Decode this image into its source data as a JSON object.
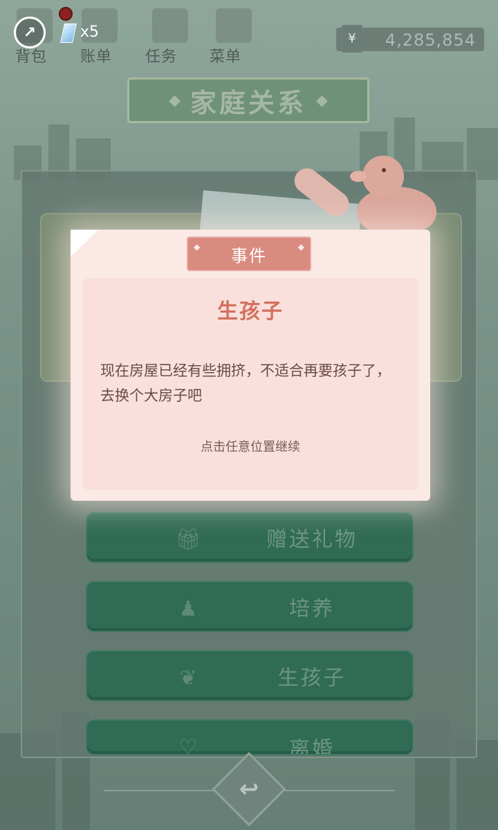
{
  "top_bar": {
    "ticket_count": "x5",
    "nav": [
      "背包",
      "账单",
      "任务",
      "菜单"
    ],
    "currency_symbol": "¥",
    "money": "4,285,854"
  },
  "banner": {
    "title": "家庭关系"
  },
  "actions": [
    {
      "label": "赠送礼物",
      "icon": "gift-icon"
    },
    {
      "label": "培养",
      "icon": "reading-child-icon"
    },
    {
      "label": "生孩子",
      "icon": "angel-icon"
    },
    {
      "label": "离婚",
      "icon": "broken-heart-icon"
    }
  ],
  "event_modal": {
    "tab_label": "事件",
    "title": "生孩子",
    "message": "现在房屋已经有些拥挤，不适合再要孩子了，去换个大房子吧",
    "hint": "点击任意位置继续"
  },
  "colors": {
    "action_button": "#2f6b55",
    "modal_background": "#fbe9e5",
    "modal_title": "#d3705f",
    "modal_tab": "#d98b80"
  }
}
